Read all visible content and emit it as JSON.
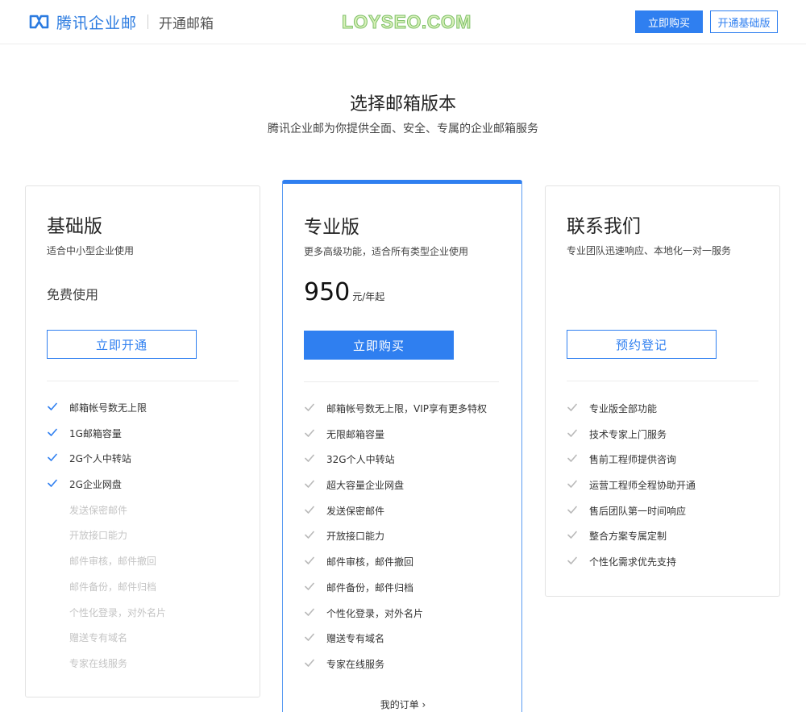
{
  "header": {
    "brand_name": "腾讯企业邮",
    "brand_sub": "开通邮箱",
    "watermark": "LOYSEO.COM",
    "buy_button": "立即购买",
    "basic_button": "开通基础版",
    "brand_color": "#2f7ff0"
  },
  "hero": {
    "title": "选择邮箱版本",
    "subtitle": "腾讯企业邮为你提供全面、安全、专属的企业邮箱服务"
  },
  "plans": {
    "basic": {
      "name": "基础版",
      "desc": "适合中小型企业使用",
      "price_text": "免费使用",
      "cta": "立即开通",
      "features": [
        {
          "text": "邮箱帐号数无上限",
          "included": true
        },
        {
          "text": "1G邮箱容量",
          "included": true
        },
        {
          "text": "2G个人中转站",
          "included": true
        },
        {
          "text": "2G企业网盘",
          "included": true
        },
        {
          "text": "发送保密邮件",
          "included": false
        },
        {
          "text": "开放接口能力",
          "included": false
        },
        {
          "text": "邮件审核，邮件撤回",
          "included": false
        },
        {
          "text": "邮件备份，邮件归档",
          "included": false
        },
        {
          "text": "个性化登录，对外名片",
          "included": false
        },
        {
          "text": "赠送专有域名",
          "included": false
        },
        {
          "text": "专家在线服务",
          "included": false
        }
      ]
    },
    "pro": {
      "name": "专业版",
      "desc": "更多高级功能，适合所有类型企业使用",
      "price": "950",
      "price_unit": "元/年起",
      "cta": "立即购买",
      "features": [
        "邮箱帐号数无上限，VIP享有更多特权",
        "无限邮箱容量",
        "32G个人中转站",
        "超大容量企业网盘",
        "发送保密邮件",
        "开放接口能力",
        "邮件审核，邮件撤回",
        "邮件备份，邮件归档",
        "个性化登录，对外名片",
        "赠送专有域名",
        "专家在线服务"
      ],
      "orders_link": "我的订单 ›"
    },
    "contact": {
      "name": "联系我们",
      "desc": "专业团队迅速响应、本地化一对一服务",
      "cta": "预约登记",
      "features": [
        "专业版全部功能",
        "技术专家上门服务",
        "售前工程师提供咨询",
        "运营工程师全程协助开通",
        "售后团队第一时间响应",
        "整合方案专属定制",
        "个性化需求优先支持"
      ]
    }
  }
}
